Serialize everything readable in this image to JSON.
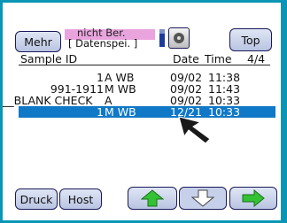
{
  "toolbar": {
    "mehr_label": "Mehr",
    "top_label": "Top"
  },
  "status": {
    "line1": "nicht Ber.",
    "line2": "[ Datenspei. ]"
  },
  "table": {
    "headers": {
      "sample_id": "Sample ID",
      "date": "Date",
      "time": "Time",
      "page": "4/4"
    },
    "rows": [
      {
        "id": "1",
        "type": "A WB",
        "date": "09/02",
        "time": "11:38"
      },
      {
        "id": "991-1911",
        "type": "M WB",
        "date": "09/02",
        "time": "11:43"
      },
      {
        "id": "__BLANK CHECK__",
        "type": "A",
        "date": "09/02",
        "time": "10:33"
      },
      {
        "id": "1",
        "type": "M WB",
        "date": "12/21",
        "time": "10:33"
      }
    ]
  },
  "bottom": {
    "druck_label": "Druck",
    "host_label": "Host"
  },
  "colors": {
    "frame": "#0a96b4",
    "selection": "#0f78c7",
    "status_bar": "#e9a4de",
    "arrow_green": "#33c233"
  },
  "icons": [
    "cf-card-icon",
    "drive-icon",
    "pointer-cursor-icon",
    "arrow-up-icon",
    "arrow-down-icon",
    "arrow-right-icon"
  ]
}
